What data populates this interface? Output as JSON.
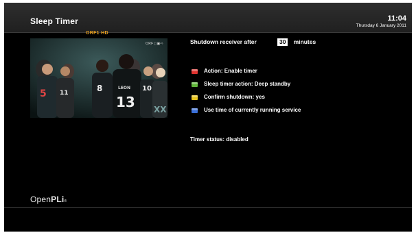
{
  "header": {
    "title": "Sleep Timer",
    "time": "11:04",
    "date": "Thursday  6 January 2011"
  },
  "preview": {
    "channel": "ORF1 HD",
    "badge": "ORF▢▣⇨",
    "jersey_numbers": [
      "5",
      "11",
      "8",
      "LEON",
      "13",
      "10",
      "XX"
    ]
  },
  "settings": {
    "shutdown_label": "Shutdown receiver after",
    "minutes_value": "30",
    "minutes_unit": "minutes"
  },
  "options": [
    {
      "label": "Action: Enable timer",
      "key_color": "#e0332f",
      "key": "red"
    },
    {
      "label": "Sleep timer action: Deep standby",
      "key_color": "#5fb53a",
      "key": "green"
    },
    {
      "label": "Confirm shutdown: yes",
      "key_color": "#e6c21a",
      "key": "yellow"
    },
    {
      "label": "Use time of currently running service",
      "key_color": "#3a6fd8",
      "key": "blue"
    }
  ],
  "status": {
    "text": "Timer status: disabled"
  },
  "footer": {
    "logo_open": "Open",
    "logo_pli": "PLi",
    "logo_dot": "®"
  }
}
